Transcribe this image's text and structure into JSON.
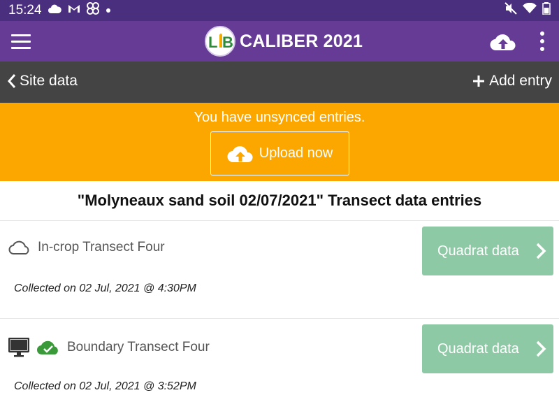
{
  "status_bar": {
    "time": "15:24",
    "left_icons": [
      "cloud-icon",
      "gmail-icon",
      "pinwheel-icon",
      "dot-icon"
    ],
    "right_icons": [
      "mute-icon",
      "wifi-icon",
      "battery-icon"
    ]
  },
  "app_bar": {
    "logo_text": "LIB",
    "title": "CALIBER 2021",
    "color": "#663b96"
  },
  "nav": {
    "back_label": "Site data",
    "add_label": "Add entry",
    "color": "#444444"
  },
  "banner": {
    "message": "You have unsynced entries.",
    "upload_label": "Upload now",
    "color": "#fca600"
  },
  "section": {
    "title": "\"Molyneaux sand soil 02/07/2021\" Transect data entries"
  },
  "entries": [
    {
      "name": "In-crop Transect Four",
      "collected": "Collected on 02 Jul, 2021 @ 4:30PM",
      "button_label": "Quadrat data",
      "icons": [
        "cloud-outline-icon"
      ]
    },
    {
      "name": "Boundary Transect Four",
      "collected": "Collected on 02 Jul, 2021 @ 3:52PM",
      "button_label": "Quadrat data",
      "icons": [
        "monitor-icon",
        "cloud-check-icon"
      ]
    }
  ],
  "colors": {
    "quadrat_button": "#8ec9a5",
    "synced_green": "#3a9a3a"
  }
}
